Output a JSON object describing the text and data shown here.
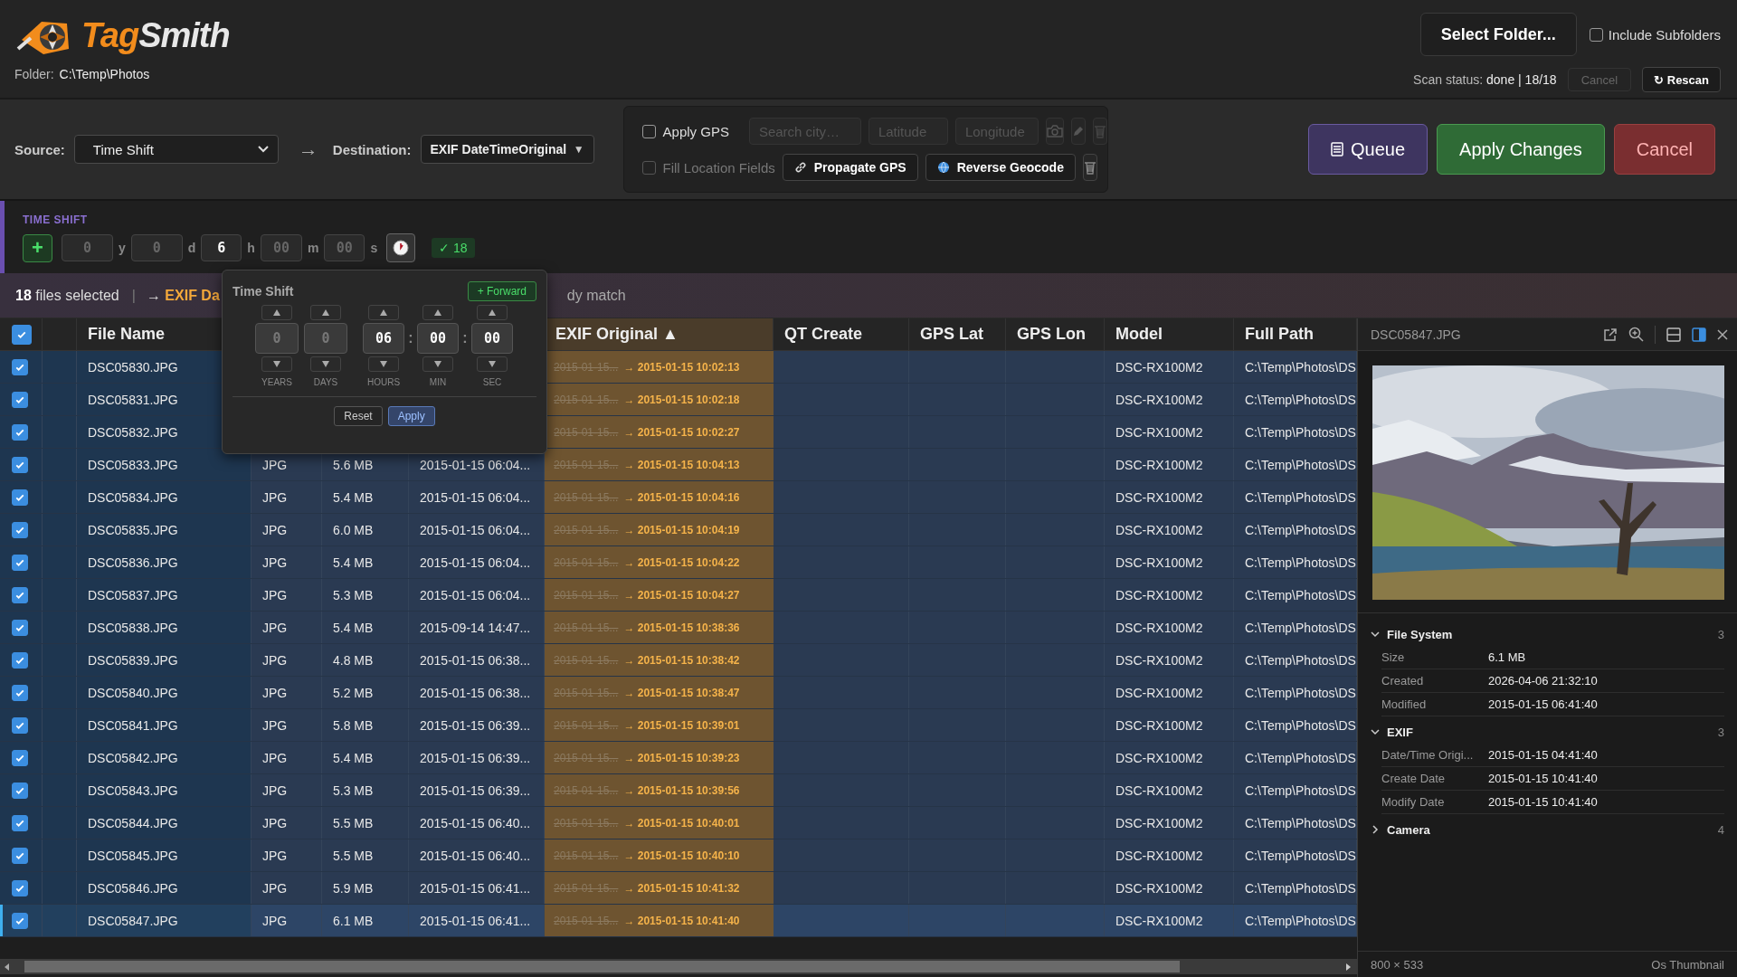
{
  "header": {
    "logo": [
      "Tag",
      "Smith"
    ],
    "folder_label": "Folder:",
    "folder_path": "C:\\Temp\\Photos",
    "select_folder": "Select Folder...",
    "include_subfolders": {
      "label": "Include Subfolders",
      "checked": false
    },
    "scan_label": "Scan status:",
    "scan_value": "done | 18/18",
    "cancel": {
      "label": "Cancel",
      "disabled": true
    },
    "rescan": "↻ Rescan"
  },
  "toolbar": {
    "source_label": "Source:",
    "source": "Time Shift",
    "arrow": "→",
    "destination_label": "Destination:",
    "destination": "EXIF DateTimeOriginal",
    "destination_caret": "▼",
    "gps": {
      "apply": {
        "label": "Apply GPS",
        "checked": false
      },
      "city_placeholder": "Search city…",
      "lat_placeholder": "Latitude",
      "lon_placeholder": "Longitude",
      "fill": {
        "label": "Fill Location Fields",
        "checked": false,
        "disabled": true
      },
      "propagate": "Propagate GPS",
      "reverse": "Reverse Geocode"
    },
    "queue": "Queue",
    "apply": "Apply Changes",
    "cancel": "Cancel"
  },
  "time_shift": {
    "title": "TIME SHIFT",
    "sign": "+",
    "fields": [
      {
        "placeholder": "0",
        "unit": "y"
      },
      {
        "placeholder": "0",
        "unit": "d"
      },
      {
        "value": "6",
        "unit": "h"
      },
      {
        "placeholder": "00",
        "unit": "m"
      },
      {
        "placeholder": "00",
        "unit": "s"
      }
    ],
    "badge": "✓ 18"
  },
  "selection_bar": {
    "count_text": "**18** files selected",
    "separator": "|",
    "arrow": "→",
    "target": "EXIF Da",
    "match_text": "dy match"
  },
  "popup": {
    "title": "Time Shift",
    "direction": "+ Forward",
    "time_separator": ":",
    "spinners": [
      {
        "kind": "date",
        "placeholder": "0",
        "label": "YEARS"
      },
      {
        "kind": "date",
        "placeholder": "0",
        "label": "DAYS"
      },
      {
        "kind": "time",
        "value": "06",
        "label": "HOURS"
      },
      {
        "kind": "time",
        "value": "00",
        "label": "MIN"
      },
      {
        "kind": "time",
        "value": "00",
        "label": "SEC"
      }
    ],
    "reset": "Reset",
    "apply": "Apply"
  },
  "table": {
    "select_all_checked": true,
    "columns": [
      {
        "label": "File Name"
      },
      {
        "label": "EXIF Original",
        "sort": "▲"
      },
      {
        "label": "QT Create"
      },
      {
        "label": "GPS Lat"
      },
      {
        "label": "GPS Lon"
      },
      {
        "label": "Model"
      },
      {
        "label": "Full Path"
      }
    ],
    "rows": [
      {
        "name": "DSC05830.JPG",
        "checked": true,
        "selected": false,
        "old": "2015-01-15...",
        "new": "→ 2015-01-15 10:02:13",
        "model": "DSC-RX100M2",
        "path": "C:\\Temp\\Photos\\DS"
      },
      {
        "name": "DSC05831.JPG",
        "checked": true,
        "selected": false,
        "old": "2015-01-15...",
        "new": "→ 2015-01-15 10:02:18",
        "model": "DSC-RX100M2",
        "path": "C:\\Temp\\Photos\\DS"
      },
      {
        "name": "DSC05832.JPG",
        "checked": true,
        "selected": false,
        "old": "2015-01-15...",
        "new": "→ 2015-01-15 10:02:27",
        "model": "DSC-RX100M2",
        "path": "C:\\Temp\\Photos\\DS"
      },
      {
        "name": "DSC05833.JPG",
        "checked": true,
        "selected": false,
        "type": "JPG",
        "size": "5.6 MB",
        "date": "2015-01-15 06:04...",
        "old": "2015-01-15...",
        "new": "→ 2015-01-15 10:04:13",
        "model": "DSC-RX100M2",
        "path": "C:\\Temp\\Photos\\DS"
      },
      {
        "name": "DSC05834.JPG",
        "checked": true,
        "selected": false,
        "type": "JPG",
        "size": "5.4 MB",
        "date": "2015-01-15 06:04...",
        "old": "2015-01-15...",
        "new": "→ 2015-01-15 10:04:16",
        "model": "DSC-RX100M2",
        "path": "C:\\Temp\\Photos\\DS"
      },
      {
        "name": "DSC05835.JPG",
        "checked": true,
        "selected": false,
        "type": "JPG",
        "size": "6.0 MB",
        "date": "2015-01-15 06:04...",
        "old": "2015-01-15...",
        "new": "→ 2015-01-15 10:04:19",
        "model": "DSC-RX100M2",
        "path": "C:\\Temp\\Photos\\DS"
      },
      {
        "name": "DSC05836.JPG",
        "checked": true,
        "selected": false,
        "type": "JPG",
        "size": "5.4 MB",
        "date": "2015-01-15 06:04...",
        "old": "2015-01-15...",
        "new": "→ 2015-01-15 10:04:22",
        "model": "DSC-RX100M2",
        "path": "C:\\Temp\\Photos\\DS"
      },
      {
        "name": "DSC05837.JPG",
        "checked": true,
        "selected": false,
        "type": "JPG",
        "size": "5.3 MB",
        "date": "2015-01-15 06:04...",
        "old": "2015-01-15...",
        "new": "→ 2015-01-15 10:04:27",
        "model": "DSC-RX100M2",
        "path": "C:\\Temp\\Photos\\DS"
      },
      {
        "name": "DSC05838.JPG",
        "checked": true,
        "selected": false,
        "type": "JPG",
        "size": "5.4 MB",
        "date": "2015-09-14 14:47...",
        "old": "2015-01-15...",
        "new": "→ 2015-01-15 10:38:36",
        "model": "DSC-RX100M2",
        "path": "C:\\Temp\\Photos\\DS"
      },
      {
        "name": "DSC05839.JPG",
        "checked": true,
        "selected": false,
        "type": "JPG",
        "size": "4.8 MB",
        "date": "2015-01-15 06:38...",
        "old": "2015-01-15...",
        "new": "→ 2015-01-15 10:38:42",
        "model": "DSC-RX100M2",
        "path": "C:\\Temp\\Photos\\DS"
      },
      {
        "name": "DSC05840.JPG",
        "checked": true,
        "selected": false,
        "type": "JPG",
        "size": "5.2 MB",
        "date": "2015-01-15 06:38...",
        "old": "2015-01-15...",
        "new": "→ 2015-01-15 10:38:47",
        "model": "DSC-RX100M2",
        "path": "C:\\Temp\\Photos\\DS"
      },
      {
        "name": "DSC05841.JPG",
        "checked": true,
        "selected": false,
        "type": "JPG",
        "size": "5.8 MB",
        "date": "2015-01-15 06:39...",
        "old": "2015-01-15...",
        "new": "→ 2015-01-15 10:39:01",
        "model": "DSC-RX100M2",
        "path": "C:\\Temp\\Photos\\DS"
      },
      {
        "name": "DSC05842.JPG",
        "checked": true,
        "selected": false,
        "type": "JPG",
        "size": "5.4 MB",
        "date": "2015-01-15 06:39...",
        "old": "2015-01-15...",
        "new": "→ 2015-01-15 10:39:23",
        "model": "DSC-RX100M2",
        "path": "C:\\Temp\\Photos\\DS"
      },
      {
        "name": "DSC05843.JPG",
        "checked": true,
        "selected": false,
        "type": "JPG",
        "size": "5.3 MB",
        "date": "2015-01-15 06:39...",
        "old": "2015-01-15...",
        "new": "→ 2015-01-15 10:39:56",
        "model": "DSC-RX100M2",
        "path": "C:\\Temp\\Photos\\DS"
      },
      {
        "name": "DSC05844.JPG",
        "checked": true,
        "selected": false,
        "type": "JPG",
        "size": "5.5 MB",
        "date": "2015-01-15 06:40...",
        "old": "2015-01-15...",
        "new": "→ 2015-01-15 10:40:01",
        "model": "DSC-RX100M2",
        "path": "C:\\Temp\\Photos\\DS"
      },
      {
        "name": "DSC05845.JPG",
        "checked": true,
        "selected": false,
        "type": "JPG",
        "size": "5.5 MB",
        "date": "2015-01-15 06:40...",
        "old": "2015-01-15...",
        "new": "→ 2015-01-15 10:40:10",
        "model": "DSC-RX100M2",
        "path": "C:\\Temp\\Photos\\DS"
      },
      {
        "name": "DSC05846.JPG",
        "checked": true,
        "selected": false,
        "type": "JPG",
        "size": "5.9 MB",
        "date": "2015-01-15 06:41...",
        "old": "2015-01-15...",
        "new": "→ 2015-01-15 10:41:32",
        "model": "DSC-RX100M2",
        "path": "C:\\Temp\\Photos\\DS"
      },
      {
        "name": "DSC05847.JPG",
        "checked": true,
        "selected": true,
        "type": "JPG",
        "size": "6.1 MB",
        "date": "2015-01-15 06:41...",
        "old": "2015-01-15...",
        "new": "→ 2015-01-15 10:41:40",
        "model": "DSC-RX100M2",
        "path": "C:\\Temp\\Photos\\DS"
      }
    ]
  },
  "panel": {
    "filename": "DSC05847.JPG",
    "layout_buttons": [
      {
        "selected": false
      },
      {
        "selected": true
      }
    ],
    "sections": [
      {
        "title": "File System",
        "count": "3",
        "expanded": true,
        "rows": [
          {
            "key": "Size",
            "value": "6.1 MB"
          },
          {
            "key": "Created",
            "value": "2026-04-06 21:32:10"
          },
          {
            "key": "Modified",
            "value": "2015-01-15 06:41:40"
          }
        ]
      },
      {
        "title": "EXIF",
        "count": "3",
        "expanded": true,
        "rows": [
          {
            "key": "Date/Time Origi...",
            "value": "2015-01-15 04:41:40"
          },
          {
            "key": "Create Date",
            "value": "2015-01-15 10:41:40"
          },
          {
            "key": "Modify Date",
            "value": "2015-01-15 10:41:40"
          }
        ]
      },
      {
        "title": "Camera",
        "count": "4",
        "expanded": false
      }
    ],
    "dimensions": "800 × 533",
    "source": "Os Thumbnail"
  }
}
